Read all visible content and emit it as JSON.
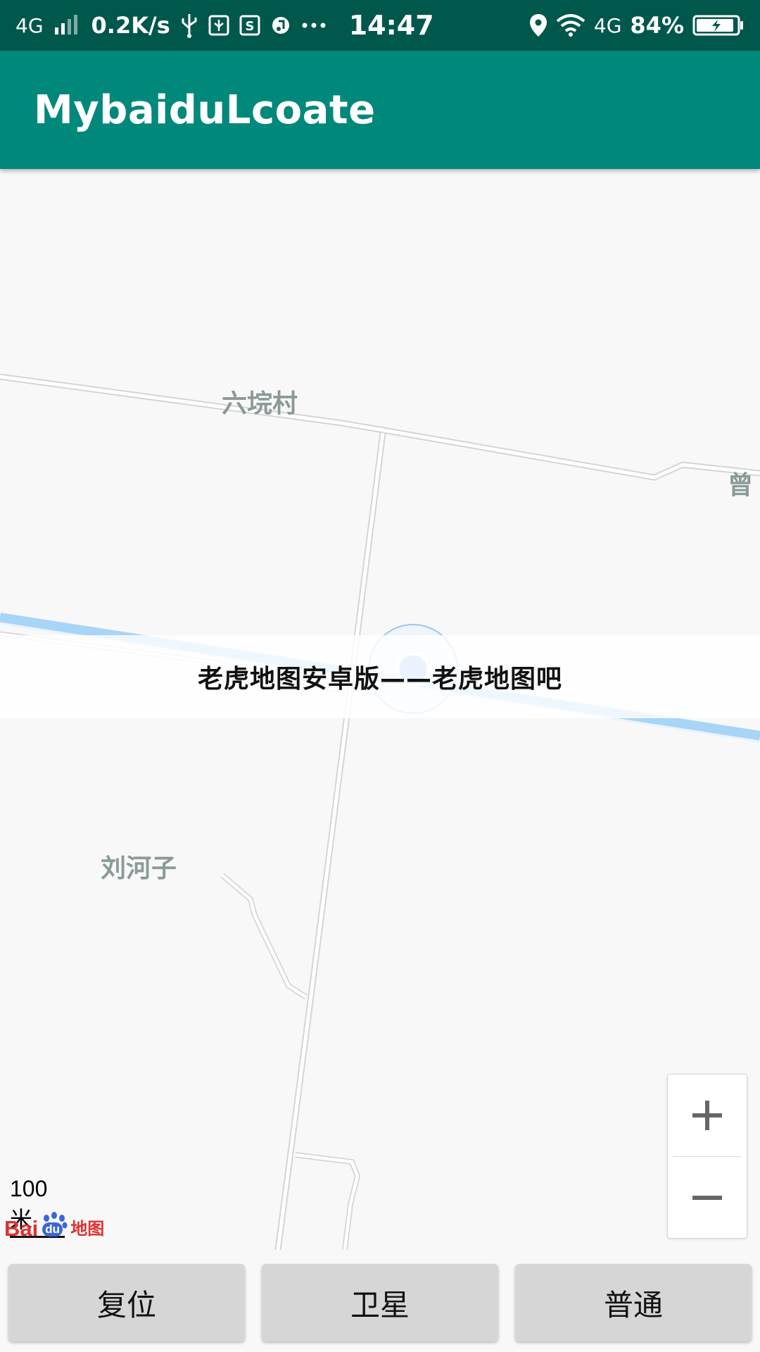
{
  "status_bar": {
    "network": "4G",
    "speed": "0.2K/s",
    "time": "14:47",
    "network_right": "4G",
    "battery": "84%"
  },
  "app_bar": {
    "title": "MybaiduLcoate"
  },
  "map": {
    "labels": {
      "village_top": "六垸村",
      "village_right": "曾",
      "village_left": "刘河子"
    },
    "banner": "老虎地图安卓版——老虎地图吧",
    "scale": "100米",
    "logo": {
      "bai": "Bai",
      "du": "du",
      "map": "地图"
    }
  },
  "controls": {
    "zoom_in_icon": "plus-icon",
    "zoom_out_icon": "minus-icon"
  },
  "buttons": {
    "reset": "复位",
    "satellite": "卫星",
    "normal": "普通"
  },
  "colors": {
    "status_bar": "#00574b",
    "app_bar": "#00897b",
    "button": "#d6d6d6",
    "river": "#a8d4f6",
    "location_dot": "#8ab4f8"
  }
}
